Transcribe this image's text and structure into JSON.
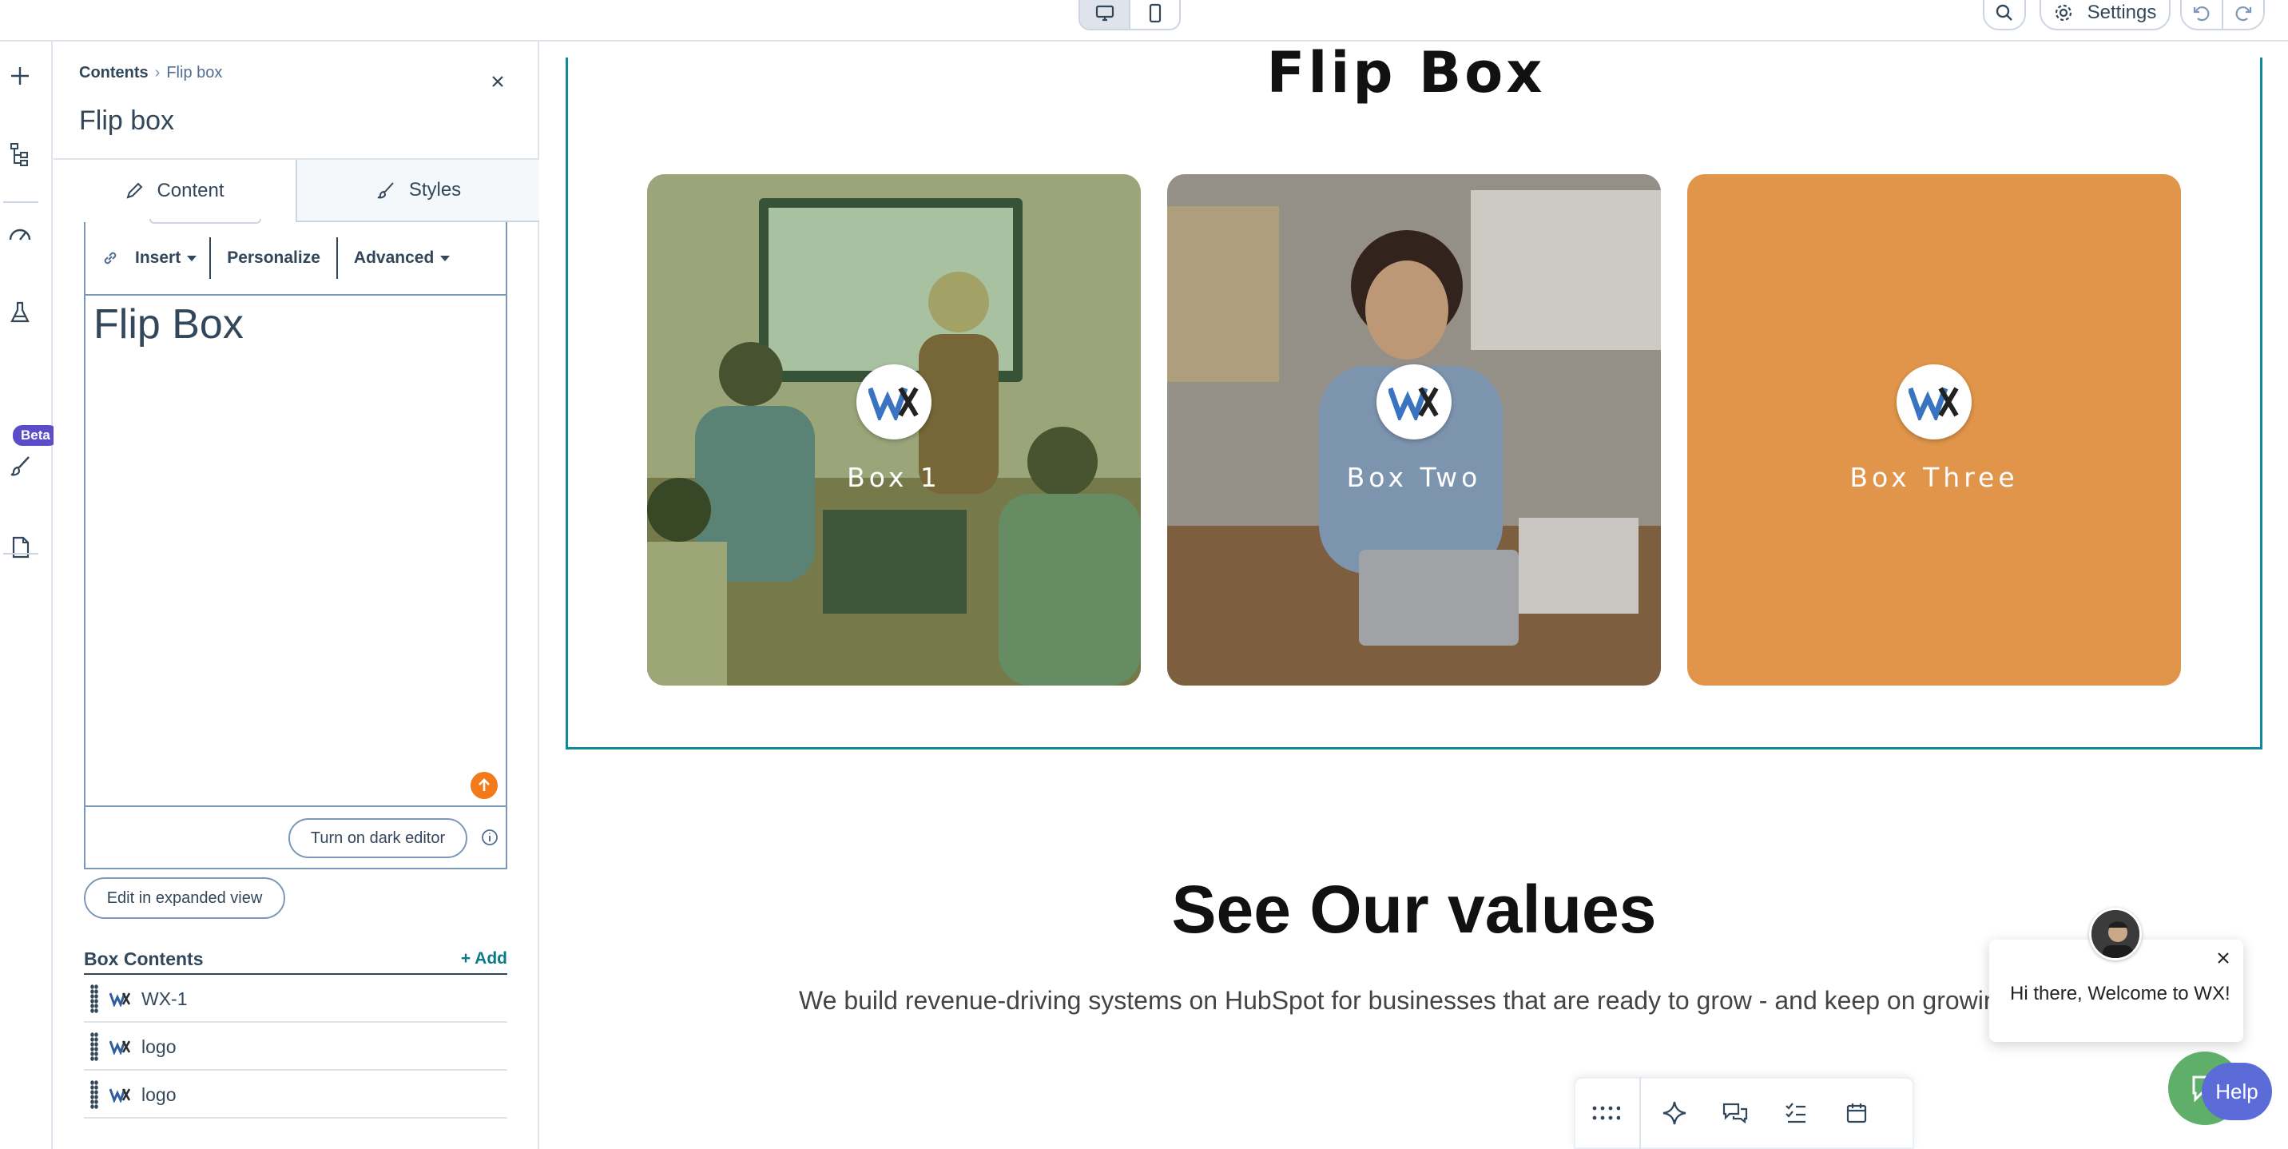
{
  "topbar": {
    "settings_label": "Settings"
  },
  "rail": {
    "beta_label": "Beta"
  },
  "panel": {
    "breadcrumb_root": "Contents",
    "breadcrumb_sep": "›",
    "breadcrumb_current": "Flip box",
    "title": "Flip box",
    "tabs": [
      {
        "label": "Content",
        "icon": "pencil-icon"
      },
      {
        "label": "Styles",
        "icon": "brush-icon"
      }
    ],
    "toolbar": {
      "insert_label": "Insert",
      "personalize_label": "Personalize",
      "advanced_label": "Advanced"
    },
    "editor_content": "Flip Box",
    "dark_editor_label": "Turn on dark editor",
    "expanded_view_label": "Edit in expanded view",
    "box_contents": {
      "title": "Box Contents",
      "add_label": "+ Add",
      "items": [
        {
          "label": "WX-1"
        },
        {
          "label": "logo"
        },
        {
          "label": "logo"
        }
      ]
    }
  },
  "canvas": {
    "heading": "Flip Box",
    "boxes": [
      {
        "label": "Box 1",
        "kind": "photo-meeting"
      },
      {
        "label": "Box Two",
        "kind": "photo-phone"
      },
      {
        "label": "Box Three",
        "kind": "solid",
        "color": "#e0954a"
      }
    ],
    "values_title": "See Our values",
    "values_subtitle": "We build revenue-driving systems on HubSpot for businesses that are ready to grow - and keep on growin"
  },
  "chat": {
    "message": "Hi there, Welcome to WX!",
    "help_label": "Help"
  },
  "colors": {
    "accent_teal": "#0f8a99",
    "orange_box": "#e0954a",
    "beta_purple": "#5c4cc7",
    "help_blue": "#5b6bd8"
  }
}
